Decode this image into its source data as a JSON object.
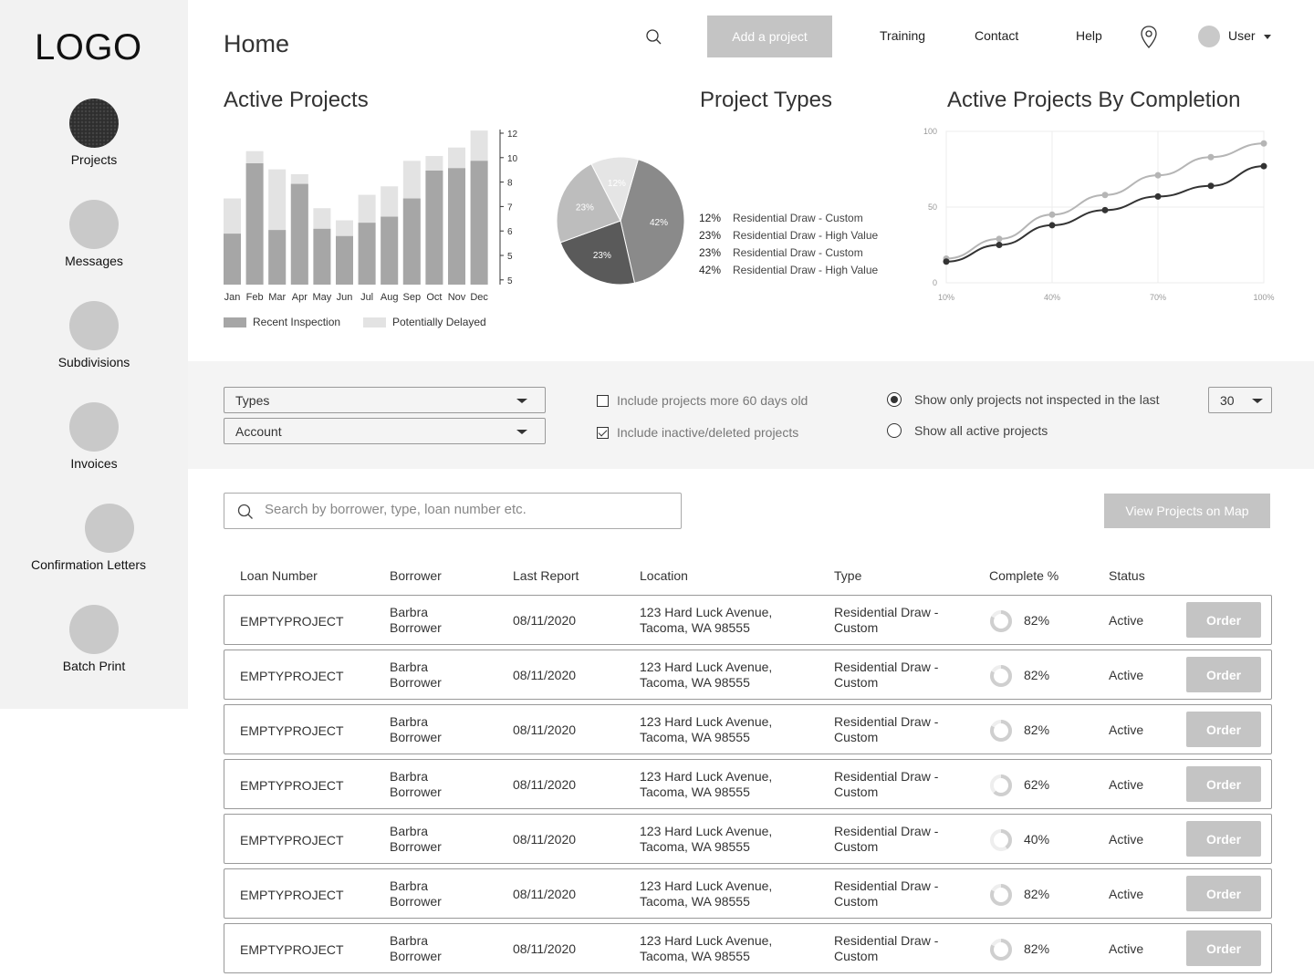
{
  "logo": "LOGO",
  "sidebar": {
    "items": [
      {
        "label": "Projects",
        "active": true
      },
      {
        "label": "Messages",
        "active": false
      },
      {
        "label": "Subdivisions",
        "active": false
      },
      {
        "label": "Invoices",
        "active": false
      },
      {
        "label": "Confirmation Letters",
        "active": false
      },
      {
        "label": "Batch Print",
        "active": false
      }
    ]
  },
  "header": {
    "title": "Home",
    "add_button": "Add a project",
    "links": [
      "Training",
      "Contact",
      "Help"
    ],
    "user": "User"
  },
  "charts": {
    "active_projects_title": "Active Projects",
    "project_types_title": "Project Types",
    "completion_title": "Active Projects By Completion"
  },
  "chart_data": [
    {
      "type": "bar",
      "title": "Active Projects",
      "categories": [
        "Jan",
        "Feb",
        "Mar",
        "Apr",
        "May",
        "Jun",
        "Jul",
        "Aug",
        "Sep",
        "Oct",
        "Nov",
        "Dec"
      ],
      "series": [
        {
          "name": "Recent Inspection",
          "values": [
            4.2,
            10,
            4.5,
            8.3,
            4.6,
            4,
            5.1,
            5.6,
            7.1,
            9.4,
            9.6,
            10.2
          ]
        },
        {
          "name": "Potentially Delayed",
          "values": [
            7.1,
            11,
            9.5,
            9.1,
            6.3,
            5.3,
            7.4,
            8.1,
            10.2,
            10.6,
            11.3,
            12.7
          ]
        }
      ],
      "y_ticks": [
        "12",
        "10",
        "8",
        "7",
        "6",
        "5",
        "5"
      ],
      "colors": {
        "Recent Inspection": "#a6a6a6",
        "Potentially Delayed": "#e3e3e3"
      }
    },
    {
      "type": "pie",
      "title": "Project Types",
      "slices": [
        {
          "label": "Residential Draw - Custom",
          "value": 12,
          "text": "12%"
        },
        {
          "label": "Residential Draw - High Value",
          "value": 23,
          "text": "23%"
        },
        {
          "label": "Residential Draw - Custom",
          "value": 23,
          "text": "23%"
        },
        {
          "label": "Residential Draw - High Value",
          "value": 42,
          "text": "42%"
        }
      ]
    },
    {
      "type": "line",
      "title": "Active Projects By Completion",
      "x_ticks": [
        "10%",
        "40%",
        "70%",
        "100%"
      ],
      "y_ticks": [
        "100",
        "50",
        "0"
      ],
      "ylim": [
        0,
        100
      ],
      "x": [
        10,
        25,
        40,
        55,
        70,
        85,
        100
      ],
      "series": [
        {
          "values": [
            16,
            29,
            45,
            58,
            71,
            83,
            92
          ],
          "color": "#b5b5b5"
        },
        {
          "values": [
            14,
            25,
            38,
            48,
            57,
            64,
            77
          ],
          "color": "#333333"
        }
      ]
    }
  ],
  "filters": {
    "types": "Types",
    "account": "Account",
    "check1": "Include projects more 60 days old",
    "check2": "Include inactive/deleted projects",
    "radio1": "Show only projects not inspected in the last",
    "radio2": "Show all active projects",
    "days": "30"
  },
  "search": {
    "placeholder": "Search by borrower, type, loan number etc."
  },
  "map_button": "View Projects on Map",
  "table": {
    "headers": [
      "Loan Number",
      "Borrower",
      "Last Report",
      "Location",
      "Type",
      "Complete %",
      "Status"
    ],
    "order_label": "Order",
    "rows": [
      {
        "loan": "EMPTYPROJECT",
        "b1": "Barbra",
        "b2": "Borrower",
        "date": "08/11/2020",
        "l1": "123 Hard Luck Avenue,",
        "l2": "Tacoma, WA 98555",
        "t1": "Residential Draw -",
        "t2": "Custom",
        "pct": "82%",
        "pct_value": 82,
        "status": "Active"
      },
      {
        "loan": "EMPTYPROJECT",
        "b1": "Barbra",
        "b2": "Borrower",
        "date": "08/11/2020",
        "l1": "123 Hard Luck Avenue,",
        "l2": "Tacoma, WA 98555",
        "t1": "Residential Draw -",
        "t2": "Custom",
        "pct": "82%",
        "pct_value": 82,
        "status": "Active"
      },
      {
        "loan": "EMPTYPROJECT",
        "b1": "Barbra",
        "b2": "Borrower",
        "date": "08/11/2020",
        "l1": "123 Hard Luck Avenue,",
        "l2": "Tacoma, WA 98555",
        "t1": "Residential Draw -",
        "t2": "Custom",
        "pct": "82%",
        "pct_value": 82,
        "status": "Active"
      },
      {
        "loan": "EMPTYPROJECT",
        "b1": "Barbra",
        "b2": "Borrower",
        "date": "08/11/2020",
        "l1": "123 Hard Luck Avenue,",
        "l2": "Tacoma, WA 98555",
        "t1": "Residential Draw -",
        "t2": "Custom",
        "pct": "62%",
        "pct_value": 62,
        "status": "Active"
      },
      {
        "loan": "EMPTYPROJECT",
        "b1": "Barbra",
        "b2": "Borrower",
        "date": "08/11/2020",
        "l1": "123 Hard Luck Avenue,",
        "l2": "Tacoma, WA 98555",
        "t1": "Residential Draw -",
        "t2": "Custom",
        "pct": "40%",
        "pct_value": 40,
        "status": "Active"
      },
      {
        "loan": "EMPTYPROJECT",
        "b1": "Barbra",
        "b2": "Borrower",
        "date": "08/11/2020",
        "l1": "123 Hard Luck Avenue,",
        "l2": "Tacoma, WA 98555",
        "t1": "Residential Draw -",
        "t2": "Custom",
        "pct": "82%",
        "pct_value": 82,
        "status": "Active"
      },
      {
        "loan": "EMPTYPROJECT",
        "b1": "Barbra",
        "b2": "Borrower",
        "date": "08/11/2020",
        "l1": "123 Hard Luck Avenue,",
        "l2": "Tacoma, WA 98555",
        "t1": "Residential Draw -",
        "t2": "Custom",
        "pct": "82%",
        "pct_value": 82,
        "status": "Active"
      }
    ]
  }
}
